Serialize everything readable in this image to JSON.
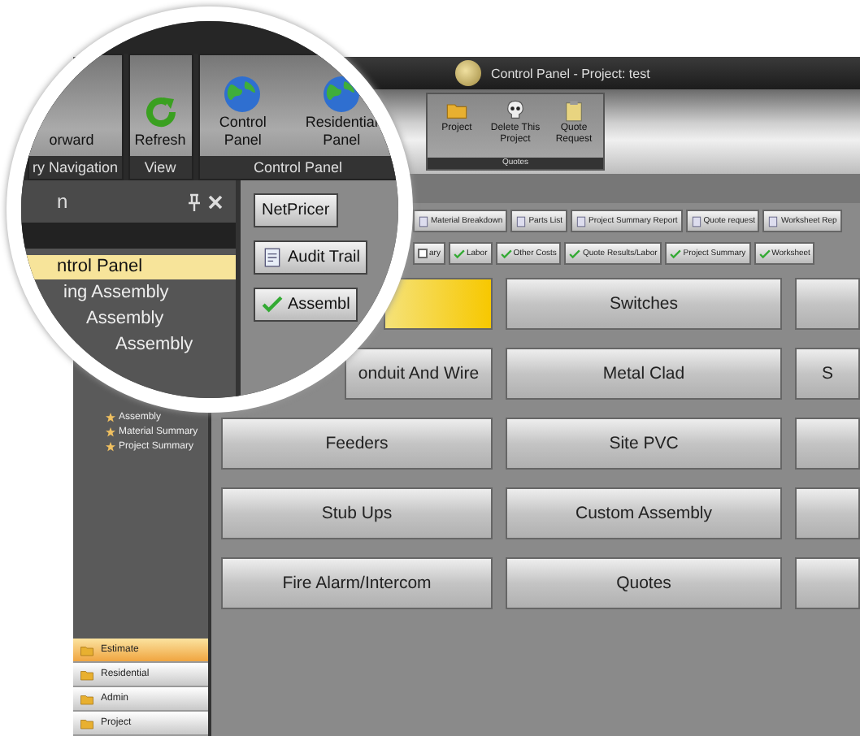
{
  "title_bar": {
    "title": "Control Panel - Project: test"
  },
  "ribbon": {
    "buttons": [
      {
        "label": "Project"
      },
      {
        "label": "Delete This Project"
      },
      {
        "label": "Quote Request"
      }
    ],
    "group_label": "Quotes"
  },
  "sidebar": {
    "tree": [
      {
        "label": "Assembly"
      },
      {
        "label": "Material Summary"
      },
      {
        "label": "Project Summary"
      }
    ],
    "nav": [
      {
        "label": "Estimate",
        "selected": true
      },
      {
        "label": "Residential",
        "selected": false
      },
      {
        "label": "Admin",
        "selected": false
      },
      {
        "label": "Project",
        "selected": false
      }
    ]
  },
  "report_buttons": [
    {
      "label": "Material Breakdown"
    },
    {
      "label": "Parts List"
    },
    {
      "label": "Project Summary Report"
    },
    {
      "label": "Quote request"
    },
    {
      "label": "Worksheet Rep"
    }
  ],
  "status_buttons": [
    {
      "label": "ary",
      "checked": false
    },
    {
      "label": "Labor",
      "checked": true
    },
    {
      "label": "Other Costs",
      "checked": true
    },
    {
      "label": "Quote Results/Labor",
      "checked": true
    },
    {
      "label": "Project Summary",
      "checked": true
    },
    {
      "label": "Worksheet",
      "checked": true
    }
  ],
  "grid": [
    [
      {
        "highlighted": true
      },
      {
        "label": "Switches",
        "highlighted": false
      },
      {
        "highlighted": false
      }
    ],
    [
      {
        "label": "onduit And Wire",
        "highlighted": false
      },
      {
        "label": "Metal Clad",
        "highlighted": false
      },
      {
        "label": "S",
        "highlighted": false
      }
    ],
    [
      {
        "label": "Feeders",
        "highlighted": false
      },
      {
        "label": "Site PVC",
        "highlighted": false
      },
      {
        "highlighted": false
      }
    ],
    [
      {
        "label": "Stub Ups",
        "highlighted": false
      },
      {
        "label": "Custom Assembly",
        "highlighted": false
      },
      {
        "highlighted": false
      }
    ],
    [
      {
        "label": "Fire Alarm/Intercom",
        "highlighted": false
      },
      {
        "label": "Quotes",
        "highlighted": false
      },
      {
        "highlighted": false
      }
    ]
  ],
  "magnifier": {
    "ribbon_groups": [
      {
        "label": "ry Navigation",
        "buttons": [
          {
            "label": "orward"
          }
        ]
      },
      {
        "label": "View",
        "buttons": [
          {
            "label": "Refresh"
          }
        ]
      },
      {
        "label": "Control Panel",
        "buttons": [
          {
            "label": "Control Panel"
          },
          {
            "label": "Residential Panel"
          }
        ]
      }
    ],
    "panel_title": "n",
    "tree": [
      {
        "label": "ntrol Panel",
        "selected": true
      },
      {
        "label": "ing Assembly",
        "selected": false
      },
      {
        "label": "Assembly",
        "selected": false
      },
      {
        "label": "Assembly",
        "selected": false
      }
    ],
    "buttons": [
      {
        "label": "NetPricer"
      },
      {
        "label": "Audit Trail"
      },
      {
        "label": "Assembl"
      }
    ]
  }
}
